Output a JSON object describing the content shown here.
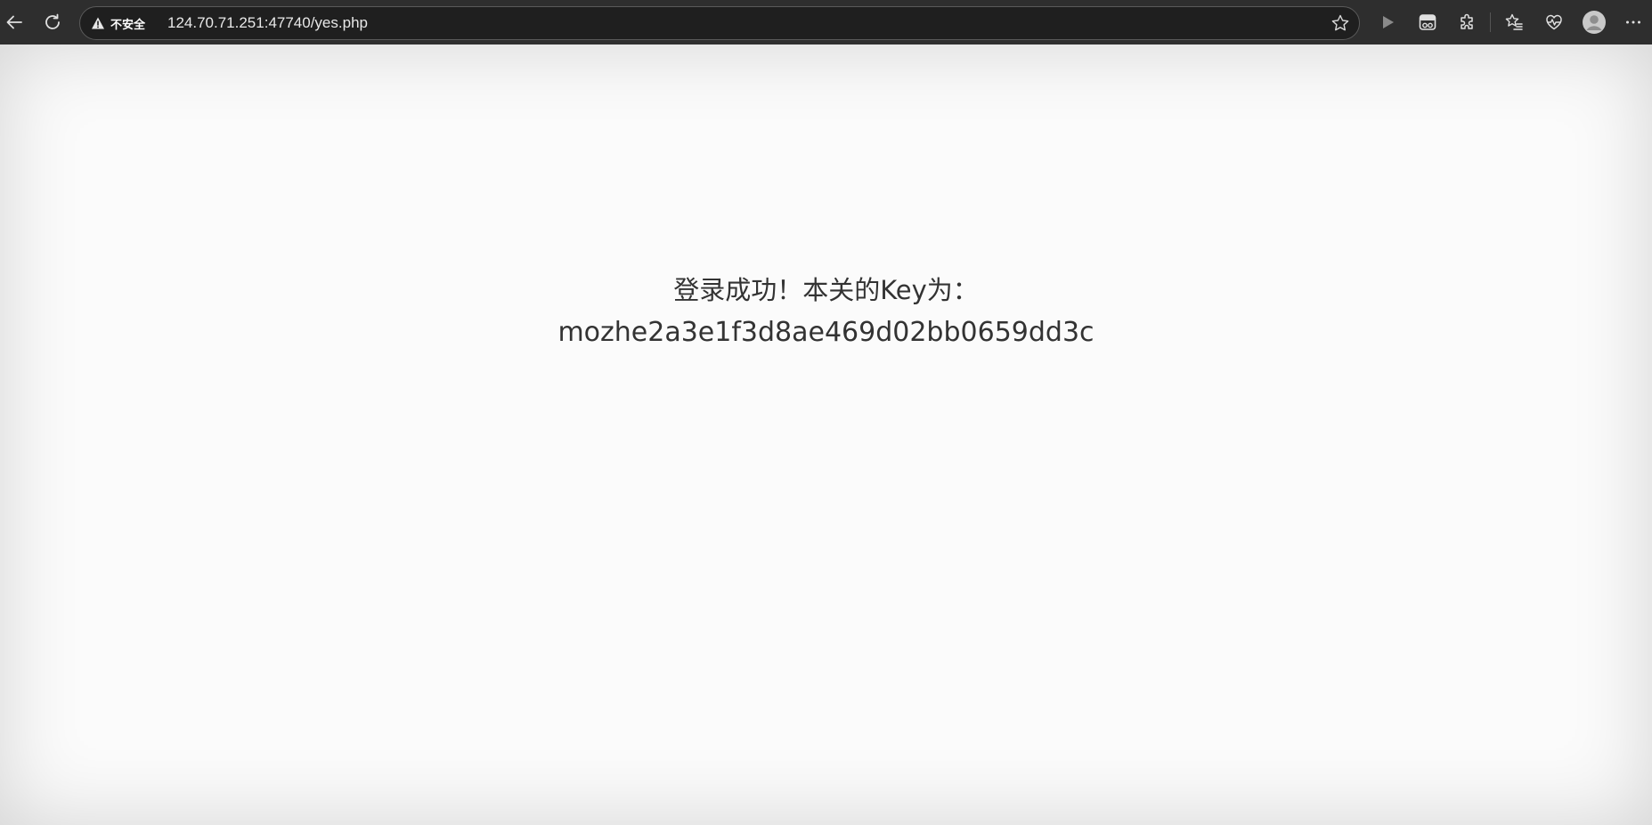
{
  "browser": {
    "security_label": "不安全",
    "url": "124.70.71.251:47740/yes.php",
    "icons": {
      "back": "arrow-left-icon",
      "refresh": "refresh-icon",
      "warning": "warning-triangle-icon",
      "favorite": "star-icon",
      "play": "play-icon",
      "extension1": "translate-extension-icon",
      "extensions": "puzzle-icon",
      "favorites": "favorites-list-icon",
      "health": "heartbeat-icon",
      "profile": "avatar-icon",
      "menu": "more-icon"
    }
  },
  "page": {
    "line1": "登录成功！本关的Key为：",
    "line2": "mozhe2a3e1f3d8ae469d02bb0659dd3c"
  },
  "colors": {
    "toolbar_bg": "#2e2e2e",
    "omnibox_bg": "#1f1f1f",
    "page_bg": "#fbfbfb",
    "text": "#333333"
  }
}
